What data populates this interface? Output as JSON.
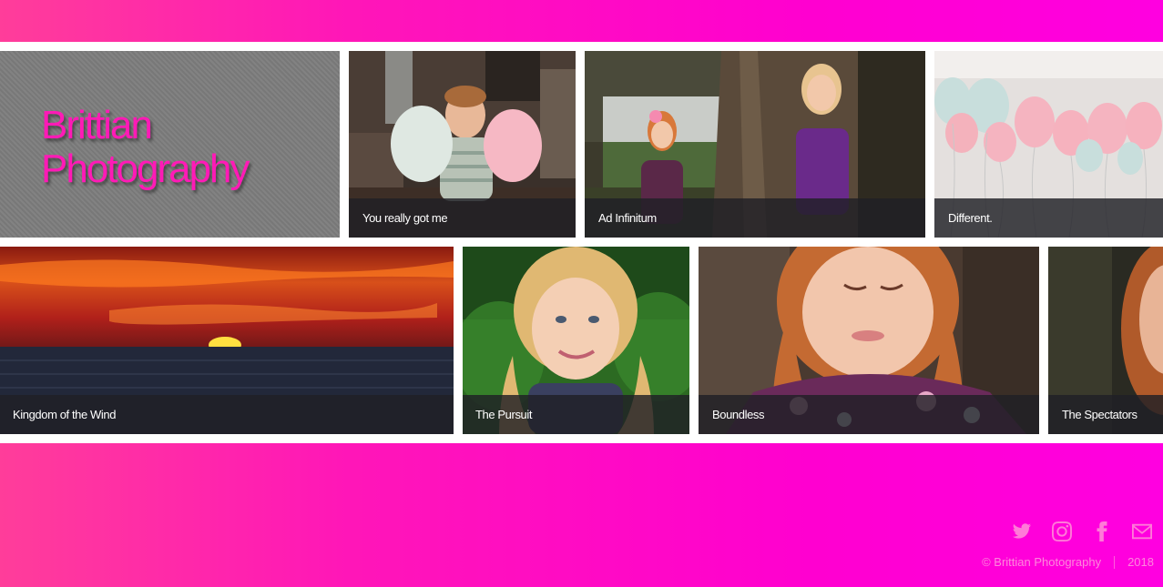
{
  "header": {
    "color_start": "#ff3d9a",
    "color_end": "#ff00e0"
  },
  "brand": {
    "line1": "Brittian",
    "line2": "Photography",
    "color": "#ff1ab6"
  },
  "gallery": {
    "row1": [
      {
        "caption": "You really got me",
        "subject": "boy-with-balloons-photo"
      },
      {
        "caption": "Ad Infinitum",
        "subject": "two-girls-by-tree-photo"
      },
      {
        "caption": "Different.",
        "subject": "balloons-photo"
      }
    ],
    "row2": [
      {
        "caption": "Kingdom of the Wind",
        "subject": "ocean-sunset-photo"
      },
      {
        "caption": "The Pursuit",
        "subject": "blonde-girl-portrait-photo"
      },
      {
        "caption": "Boundless",
        "subject": "redhead-girl-portrait-photo"
      },
      {
        "caption": "The Spectators",
        "subject": "girl-partial-photo"
      }
    ]
  },
  "footer": {
    "social": [
      "twitter-icon",
      "instagram-icon",
      "facebook-icon",
      "email-icon"
    ],
    "copyright": "© Brittian Photography",
    "year": "2018"
  }
}
